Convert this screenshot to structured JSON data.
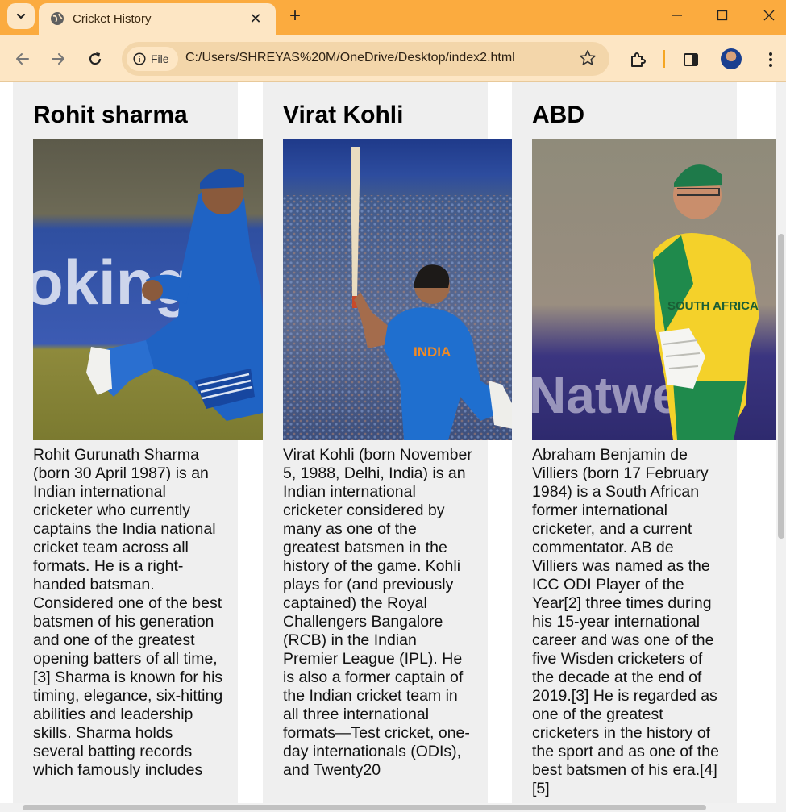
{
  "browser": {
    "tab_title": "Cricket History",
    "tab_close": "✕",
    "new_tab": "+",
    "site_chip": "File",
    "url": "C:/Users/SHREYAS%20M/OneDrive/Desktop/index2.html"
  },
  "players": [
    {
      "name": "Rohit sharma",
      "bio": "Rohit Gurunath Sharma (born 30 April 1987) is an Indian international cricketer who currently captains the India national cricket team across all formats. He is a right-handed batsman. Considered one of the best batsmen of his generation and one of the greatest opening batters of all time,[3] Sharma is known for his timing, elegance, six-hitting abilities and leadership skills. Sharma holds several batting records which famously includes"
    },
    {
      "name": "Virat Kohli",
      "bio": "Virat Kohli (born November 5, 1988, Delhi, India) is an Indian international cricketer considered by many as one of the greatest batsmen in the history of the game. Kohli plays for (and previously captained) the Royal Challengers Bangalore (RCB) in the Indian Premier League (IPL). He is also a former captain of the Indian cricket team in all three international formats—Test cricket, one-day internationals (ODIs), and Twenty20"
    },
    {
      "name": "ABD",
      "bio": "Abraham Benjamin de Villiers (born 17 February 1984) is a South African former international cricketer, and a current commentator. AB de Villiers was named as the ICC ODI Player of the Year[2] three times during his 15-year international career and was one of the five Wisden cricketers of the decade at the end of 2019.[3] He is regarded as one of the greatest cricketers in the history of the sport and as one of the best batsmen of his era.[4][5]"
    }
  ]
}
